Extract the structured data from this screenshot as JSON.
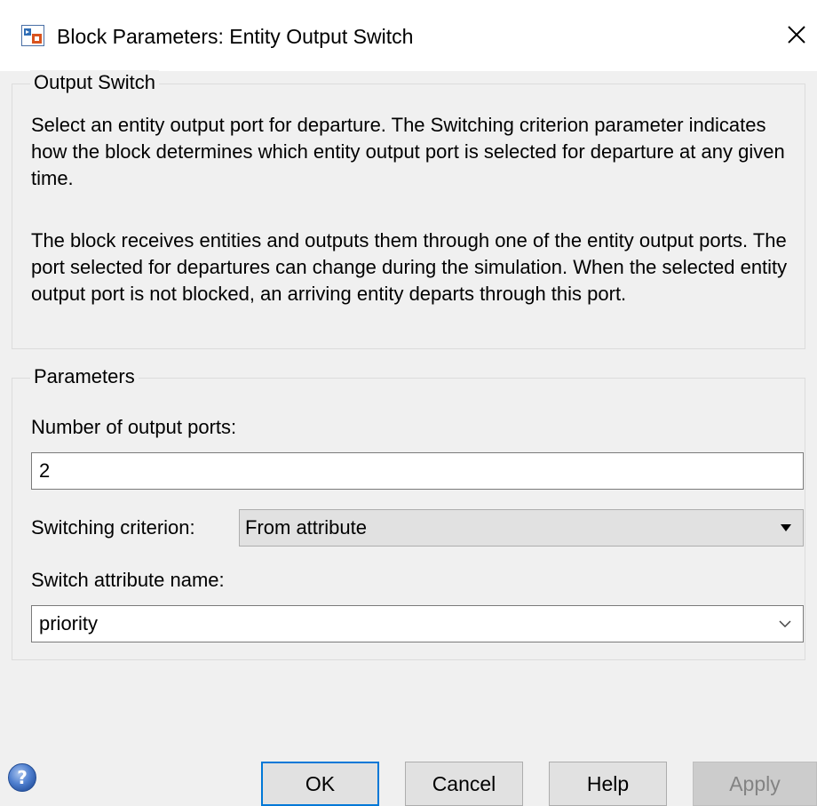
{
  "window": {
    "title": "Block Parameters: Entity Output Switch"
  },
  "output_switch": {
    "legend": "Output Switch",
    "paragraph1": "Select an entity output port for departure. The Switching criterion parameter indicates how the block determines which entity output port is selected for departure at any given time.",
    "paragraph2": "The block receives entities and outputs them through one of the entity output ports. The port selected for departures can change during the simulation. When the selected entity output port is not blocked, an arriving entity departs through this port."
  },
  "parameters": {
    "legend": "Parameters",
    "num_ports_label": "Number of output ports:",
    "num_ports_value": "2",
    "criterion_label": "Switching criterion:",
    "criterion_value": "From attribute",
    "attr_label": "Switch attribute name:",
    "attr_value": "priority"
  },
  "buttons": {
    "ok": "OK",
    "cancel": "Cancel",
    "help": "Help",
    "apply": "Apply"
  },
  "icons": {
    "app": "block-parameters-icon",
    "close": "close-icon",
    "help": "help-circle-icon",
    "dropdown": "chevron-down-icon"
  },
  "colors": {
    "accent": "#0078d7",
    "help_icon": "#3d6bb8"
  }
}
